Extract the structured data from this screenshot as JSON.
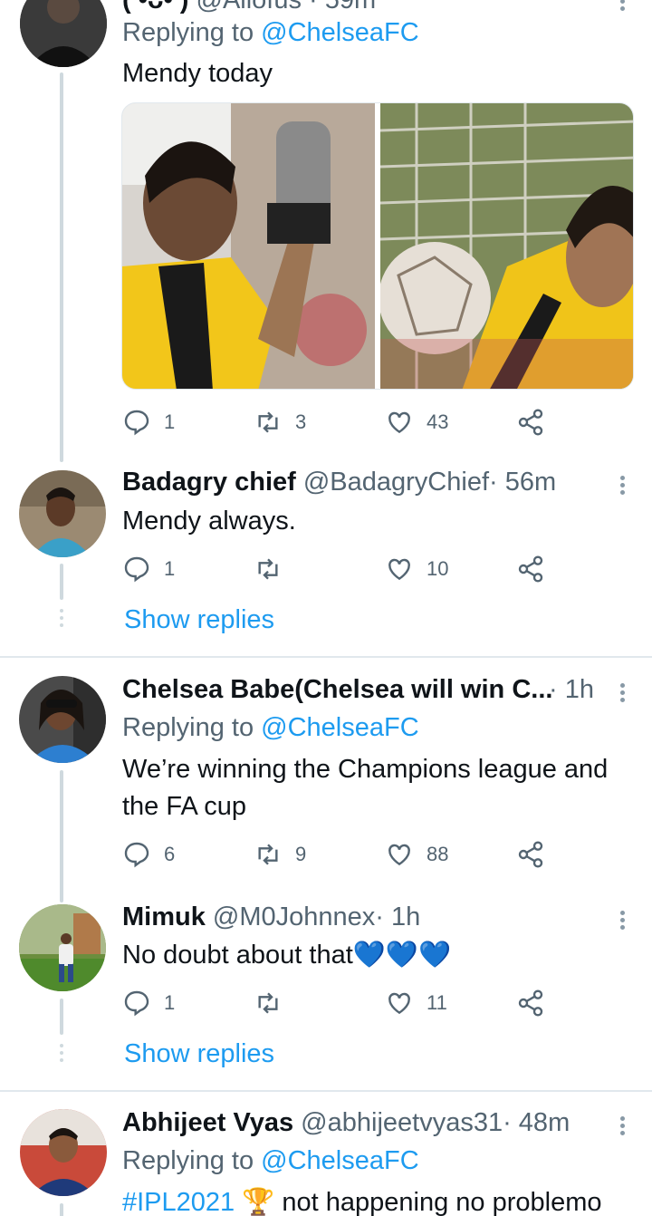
{
  "tweet1": {
    "name_partial": "( •ᴗ• )",
    "meta_partial": "@Allofus · 59m",
    "replying_label": "Replying to",
    "replying_handle": "@ChelseaFC",
    "text": "Mendy today",
    "actions": {
      "reply": "1",
      "retweet": "3",
      "like": "43"
    }
  },
  "tweet2": {
    "name": "Badagry chief",
    "handle": "@BadagryChief",
    "time": "· 56m",
    "text": "Mendy always.",
    "actions": {
      "reply": "1",
      "retweet": "",
      "like": "10"
    }
  },
  "show_replies_1": "Show replies",
  "tweet3": {
    "name": "Chelsea Babe(Chelsea will win C...",
    "time": "· 1h",
    "replying_label": "Replying to",
    "replying_handle": "@ChelseaFC",
    "text_line1": "We’re winning the Champions league and",
    "text_line2": "the FA cup",
    "actions": {
      "reply": "6",
      "retweet": "9",
      "like": "88"
    }
  },
  "tweet4": {
    "name": "Mimuk",
    "handle": "@M0Johnnex",
    "time": "· 1h",
    "text": "No doubt about that",
    "emoji": "💙💙💙",
    "actions": {
      "reply": "1",
      "retweet": "",
      "like": "11"
    }
  },
  "show_replies_2": "Show replies",
  "tweet5": {
    "name": "Abhijeet Vyas",
    "handle": "@abhijeetvyas31",
    "time": "· 48m",
    "replying_label": "Replying to",
    "replying_handle": "@ChelseaFC",
    "hashtag": "#IPL2021",
    "trophy": "🏆",
    "text": "not happening no problemo"
  },
  "colors": {
    "accent": "#1d9bf0",
    "muted": "#536471",
    "thread": "#cfd9de"
  }
}
